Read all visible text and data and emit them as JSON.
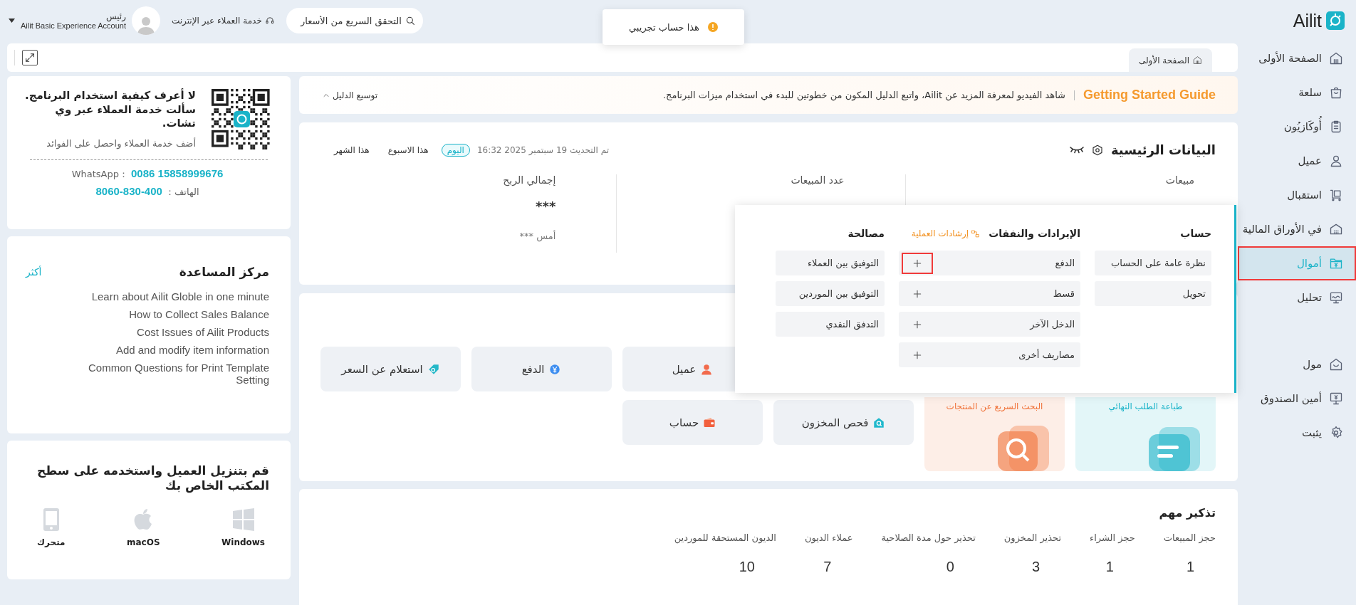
{
  "topbar": {
    "logo": "Ailit",
    "search": {
      "placeholder": "التحقق السريع من الأسعار"
    },
    "support": "خدمة العملاء عبر الإنترنت",
    "user": {
      "role": "رئيس",
      "account": "Ailit Basic Experience Account"
    }
  },
  "toast": {
    "message": "هذا حساب تجريبي"
  },
  "sidebar": {
    "items": [
      {
        "label": "الصفحة الأولى",
        "selected": false,
        "highlighted": false
      },
      {
        "label": "سلعة",
        "selected": false,
        "highlighted": false
      },
      {
        "label": "أُوكَازيُون",
        "selected": false,
        "highlighted": false
      },
      {
        "label": "عميل",
        "selected": false,
        "highlighted": false
      },
      {
        "label": "استقبال",
        "selected": false,
        "highlighted": false
      },
      {
        "label": "في الأوراق المالية",
        "selected": false,
        "highlighted": false
      },
      {
        "label": "أموال",
        "selected": true,
        "highlighted": true
      },
      {
        "label": "تحليل",
        "selected": false,
        "highlighted": false
      }
    ],
    "bottom_items": [
      {
        "label": "مول",
        "selected": false
      },
      {
        "label": "أمين الصندوق",
        "selected": false
      },
      {
        "label": "يثبت",
        "selected": false
      }
    ]
  },
  "tabs": [
    {
      "label": "الصفحة الأولى",
      "selected": true
    }
  ],
  "guide": {
    "title": "Getting Started Guide",
    "text": "شاهد الفيديو لمعرفة المزيد عن Ailit، واتبع الدليل المكون من خطوتين للبدء في استخدام ميزات البرنامج.",
    "toggle": "توسيع الدليل"
  },
  "overview": {
    "title": "البيانات الرئيسية",
    "updated": "تم التحديث 19 سبتمبر 2025 16:32",
    "periods": [
      {
        "label": "اليوم",
        "selected": true
      },
      {
        "label": "هذا الاسبوع",
        "selected": false
      },
      {
        "label": "هذا الشهر",
        "selected": false
      }
    ],
    "stats": [
      {
        "label": "مبيعات"
      },
      {
        "label": "عدد المبيعات"
      },
      {
        "label": "إجمالي الربح",
        "value": "***",
        "yesterday": "أمس ***"
      }
    ]
  },
  "quick": {
    "features": [
      {
        "label": "طباعة الطلب النهائي",
        "color": "#1ab3c8"
      },
      {
        "label": "البحث السريع عن المنتجات",
        "color": "#f0733a"
      }
    ],
    "buttons": [
      {
        "label": "عميل"
      },
      {
        "label": "الدفع"
      },
      {
        "label": "استعلام عن السعر"
      },
      {
        "label": "فحص المخزون"
      },
      {
        "label": "حساب"
      }
    ]
  },
  "menu": {
    "columns": [
      {
        "title": "حساب",
        "items": [
          {
            "label": "نظرة عامة على الحساب"
          },
          {
            "label": "تحويل"
          }
        ]
      },
      {
        "title": "الإيرادات والنفقات",
        "link": "إرشادات العملية",
        "items": [
          {
            "label": "الدفع",
            "add": true,
            "highlighted": true
          },
          {
            "label": "قسط",
            "add": true,
            "highlighted": false
          },
          {
            "label": "الدخل الآخر",
            "add": true,
            "highlighted": false
          },
          {
            "label": "مصاريف أخرى",
            "add": true,
            "highlighted": false
          }
        ]
      },
      {
        "title": "مصالحة",
        "items": [
          {
            "label": "التوفيق بين العملاء"
          },
          {
            "label": "التوفيق بين الموردين"
          },
          {
            "label": "التدفق النقدي"
          }
        ]
      }
    ]
  },
  "reminders": {
    "title": "تذكير مهم",
    "items": [
      {
        "label": "حجز المبيعات",
        "value": "1"
      },
      {
        "label": "حجز الشراء",
        "value": "1"
      },
      {
        "label": "تحذير المخزون",
        "value": "3"
      },
      {
        "label": "تحذير حول مدة الصلاحية",
        "value": "0"
      },
      {
        "label": "عملاء الديون",
        "value": "7"
      },
      {
        "label": "الديون المستحقة للموردين",
        "value": "10"
      }
    ]
  },
  "support_card": {
    "title": "لا أعرف كيفية استخدام البرنامج. سألت خدمة العملاء عبر وي تشات.",
    "subtitle": "أضف خدمة العملاء واحصل على الفوائد",
    "contacts": [
      {
        "label": "WhatsApp：",
        "value": "0086 15858999676"
      },
      {
        "label": "الهاتف：",
        "value": "8060-830-400"
      }
    ]
  },
  "help": {
    "title": "مركز المساعدة",
    "more": "أكثر",
    "articles": [
      "Learn about Ailit Globle in one minute",
      "How to Collect Sales Balance",
      "Cost Issues of Ailit Products",
      "Add and modify item information",
      "Common Questions for Print Template Setting"
    ]
  },
  "download": {
    "title": "قم بتنزيل العميل واستخدمه على سطح المكتب الخاص بك",
    "platforms": [
      {
        "label": "Windows"
      },
      {
        "label": "macOS"
      },
      {
        "label": "متحرك"
      }
    ]
  }
}
